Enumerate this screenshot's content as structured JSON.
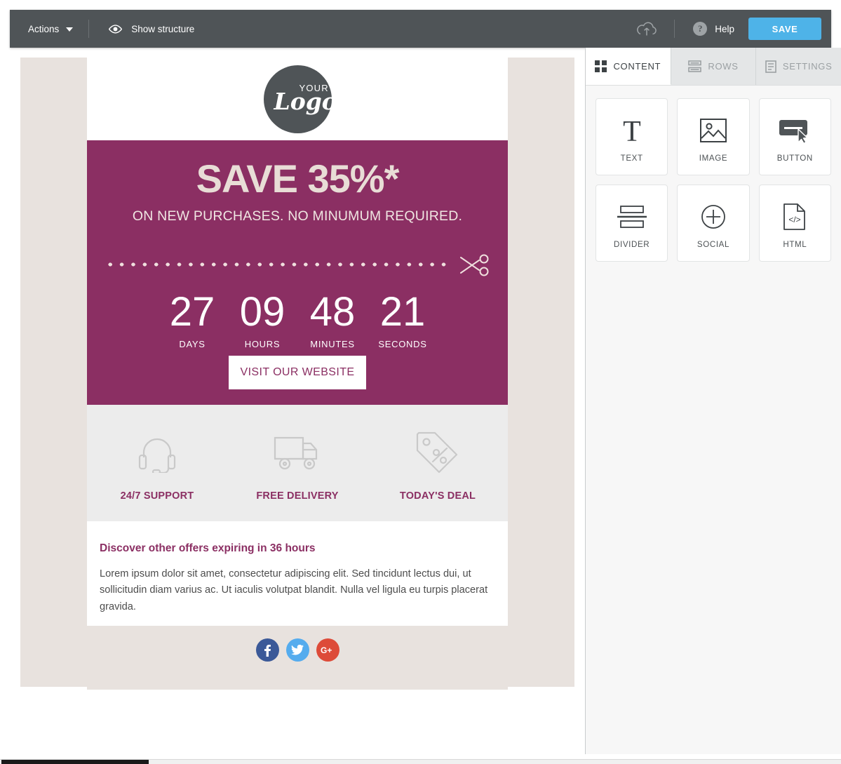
{
  "toolbar": {
    "actions_label": "Actions",
    "show_structure_label": "Show structure",
    "help_label": "Help",
    "save_label": "SAVE",
    "save_color": "#4eb3e8",
    "bar_color": "#4f5457",
    "icons": {
      "eye": "eye-icon",
      "chevron": "chevron-down-icon",
      "cloud": "cloud-upload-icon",
      "help": "question-mark-icon"
    }
  },
  "panel": {
    "tabs": [
      {
        "label": "CONTENT",
        "icon": "grid-icon",
        "active": true
      },
      {
        "label": "ROWS",
        "icon": "rows-icon",
        "active": false
      },
      {
        "label": "SETTINGS",
        "icon": "settings-lines-icon",
        "active": false
      }
    ],
    "blocks": [
      {
        "label": "TEXT",
        "icon": "text-t-icon"
      },
      {
        "label": "IMAGE",
        "icon": "image-icon"
      },
      {
        "label": "BUTTON",
        "icon": "button-icon"
      },
      {
        "label": "DIVIDER",
        "icon": "divider-icon"
      },
      {
        "label": "SOCIAL",
        "icon": "social-plus-icon"
      },
      {
        "label": "HTML",
        "icon": "html-code-icon"
      }
    ]
  },
  "email": {
    "background_color": "#e8e2de",
    "accent_color": "#8b2f63",
    "logo": {
      "top_text": "YOUR",
      "main_text": "Logo"
    },
    "hero": {
      "headline": "SAVE 35%*",
      "subhead": "ON NEW PURCHASES. NO MINUMUM REQUIRED.",
      "scissors_icon": "scissors-icon",
      "countdown": [
        {
          "value": "27",
          "label": "DAYS"
        },
        {
          "value": "09",
          "label": "HOURS"
        },
        {
          "value": "48",
          "label": "MINUTES"
        },
        {
          "value": "21",
          "label": "SECONDS"
        }
      ],
      "cta_label": "VISIT OUR WEBSITE"
    },
    "features": [
      {
        "label": "24/7 SUPPORT",
        "icon": "headset-icon"
      },
      {
        "label": "FREE DELIVERY",
        "icon": "truck-icon"
      },
      {
        "label": "TODAY'S DEAL",
        "icon": "price-tag-icon"
      }
    ],
    "text_block": {
      "title": "Discover other offers expiring in 36 hours",
      "paragraph": "Lorem ipsum dolor sit amet, consectetur adipiscing elit. Sed tincidunt lectus dui, ut sollicitudin diam varius ac. Ut iaculis volutpat blandit. Nulla vel ligula eu turpis placerat gravida."
    },
    "social": [
      {
        "name": "facebook",
        "glyph": "f",
        "color": "#3b5998"
      },
      {
        "name": "twitter",
        "glyph": "t",
        "color": "#55acee"
      },
      {
        "name": "googleplus",
        "glyph": "G+",
        "color": "#dd4b39"
      }
    ]
  }
}
